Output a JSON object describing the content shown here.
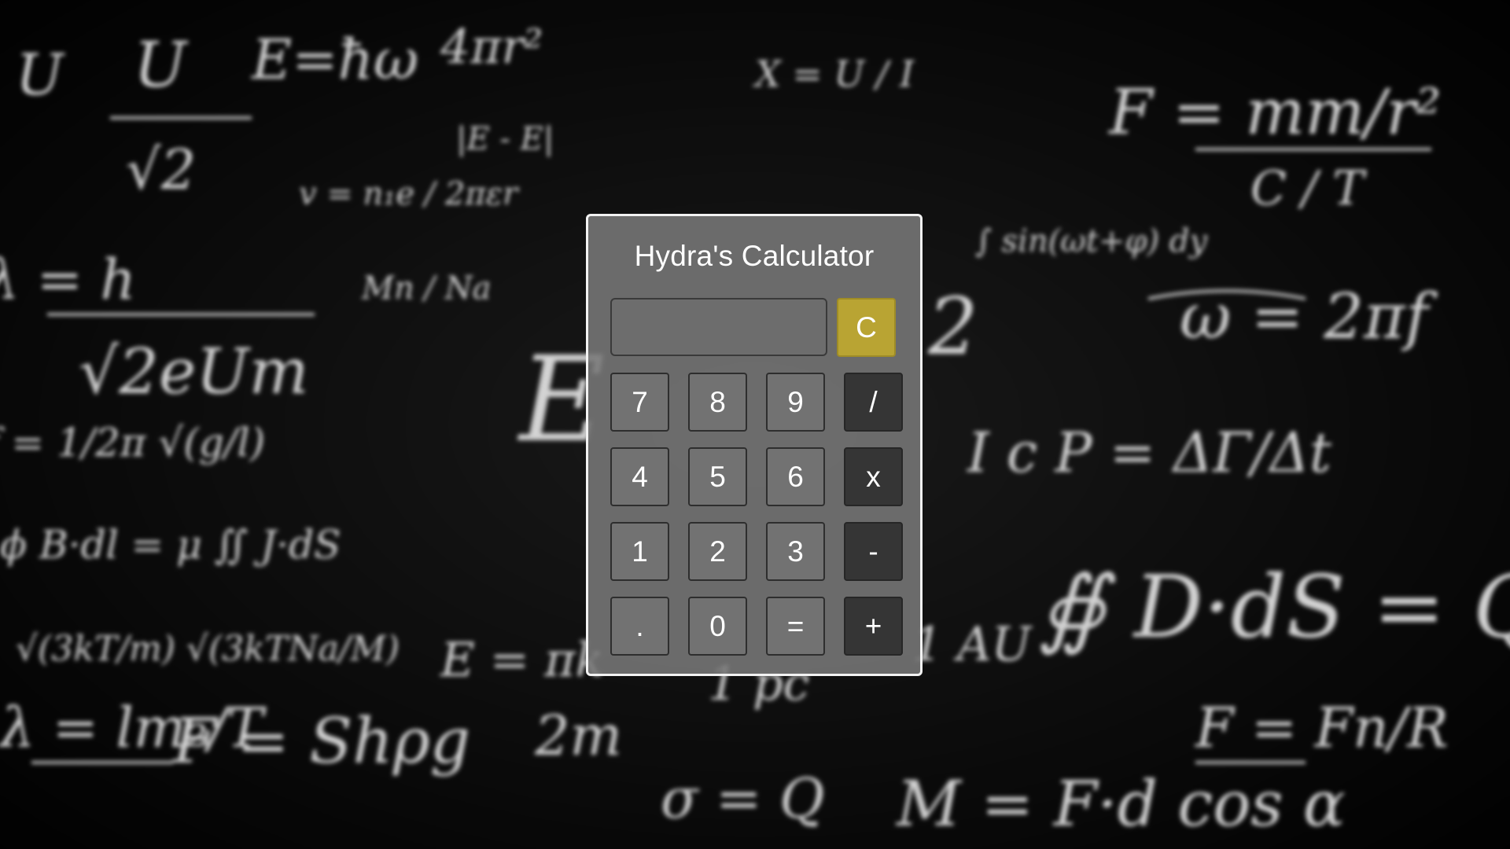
{
  "calculator": {
    "title": "Hydra's Calculator",
    "display_value": "",
    "clear_label": "C",
    "buttons": {
      "seven": "7",
      "eight": "8",
      "nine": "9",
      "divide": "/",
      "four": "4",
      "five": "5",
      "six": "6",
      "multiply": "x",
      "one": "1",
      "two": "2",
      "three": "3",
      "minus": "-",
      "decimal": ".",
      "zero": "0",
      "equals": "=",
      "plus": "+"
    }
  },
  "colors": {
    "clear_button": "#b9a433",
    "operator_button": "#353535",
    "number_button": "#737373",
    "panel_border": "#f2f2f2"
  }
}
